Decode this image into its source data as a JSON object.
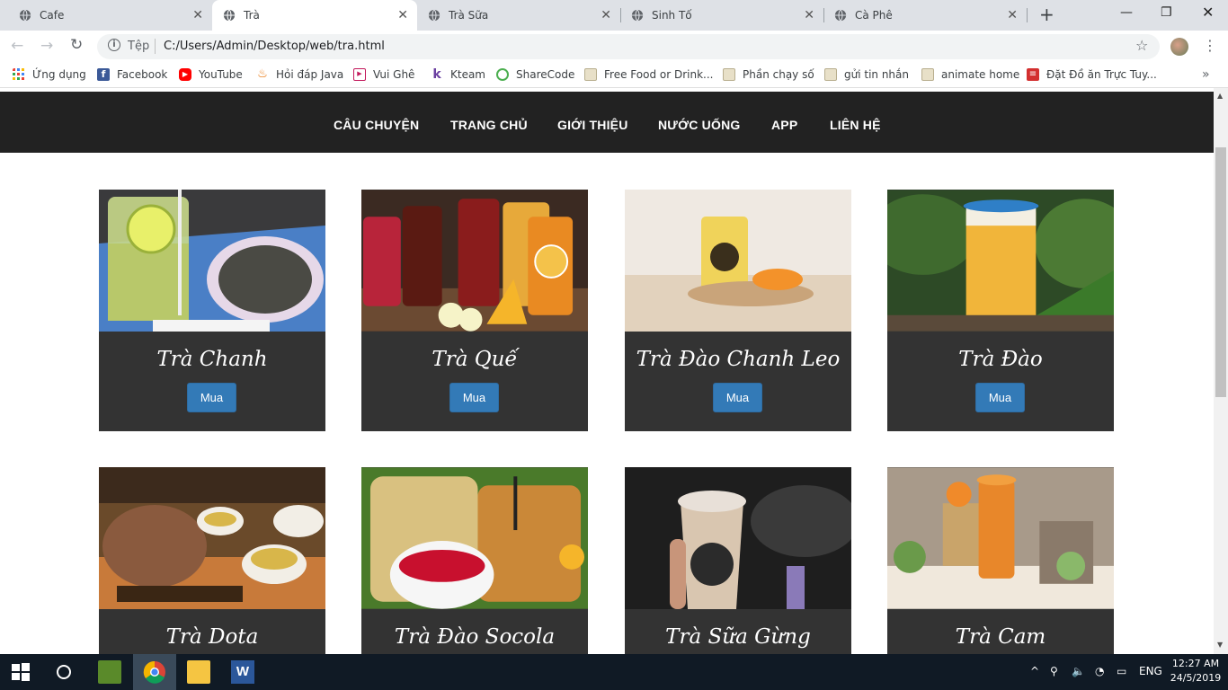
{
  "browser": {
    "tabs": [
      {
        "title": "Cafe"
      },
      {
        "title": "Trà"
      },
      {
        "title": "Trà Sữa"
      },
      {
        "title": "Sinh Tố"
      },
      {
        "title": "Cà Phê"
      }
    ],
    "address": {
      "scheme_label": "Tệp",
      "url": "C:/Users/Admin/Desktop/web/tra.html"
    },
    "bookmarks": [
      {
        "label": "Ứng dụng",
        "icon": "apps-grid-icon"
      },
      {
        "label": "Facebook",
        "icon": "facebook-icon"
      },
      {
        "label": "YouTube",
        "icon": "youtube-icon"
      },
      {
        "label": "Hỏi đáp Java",
        "icon": "java-icon"
      },
      {
        "label": "Vui Ghê",
        "icon": "play-icon"
      },
      {
        "label": "Kteam",
        "icon": "kteam-icon"
      },
      {
        "label": "ShareCode",
        "icon": "sharecode-icon"
      },
      {
        "label": "Free Food or Drink...",
        "icon": "folder-icon"
      },
      {
        "label": "Phần chạy số",
        "icon": "folder-icon"
      },
      {
        "label": "gửi tin nhắn",
        "icon": "folder-icon"
      },
      {
        "label": "animate home",
        "icon": "folder-icon"
      },
      {
        "label": "Đặt Đồ ăn Trực Tuy...",
        "icon": "menu-icon"
      }
    ]
  },
  "site": {
    "nav": [
      "CÂU CHUYỆN",
      "TRANG CHỦ",
      "GIỚI THIỆU",
      "NƯỚC UỐNG",
      "APP",
      "LIÊN HỆ"
    ],
    "buy_label": "Mua",
    "products": [
      {
        "name": "Trà Chanh"
      },
      {
        "name": "Trà Quế"
      },
      {
        "name": "Trà Đào Chanh Leo"
      },
      {
        "name": "Trà Đào"
      },
      {
        "name": "Trà Dota"
      },
      {
        "name": "Trà Đào Socola"
      },
      {
        "name": "Trà Sữa Gừng"
      },
      {
        "name": "Trà Cam"
      }
    ]
  },
  "taskbar": {
    "lang": "ENG",
    "time": "12:27 AM",
    "date": "24/5/2019"
  },
  "colors": {
    "nav_bg": "#222222",
    "card_bg": "#333333",
    "button": "#337ab7",
    "taskbar": "#101a25"
  }
}
